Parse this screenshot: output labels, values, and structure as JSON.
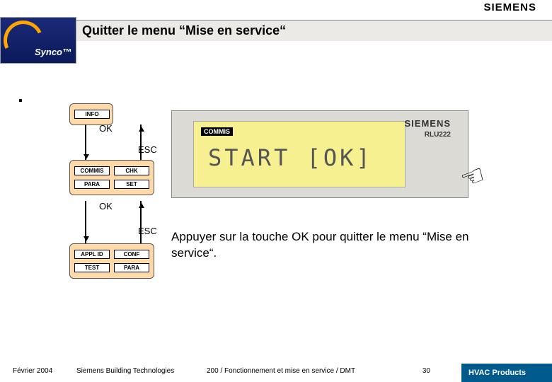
{
  "brand_top": "SIEMENS",
  "synco_label": "Synco™",
  "title": "Quitter le menu “Mise en service“",
  "dot": "▪",
  "menu1": {
    "info": "INFO"
  },
  "menu2": {
    "commis": "COMMIS",
    "chk": "CHK",
    "para": "PARA",
    "set": "SET"
  },
  "menu3": {
    "appl": "APPL ID",
    "conf": "CONF",
    "test": "TEST",
    "para": "PARA"
  },
  "labels": {
    "ok": "OK",
    "esc": "ESC"
  },
  "device": {
    "commis": "COMMIS",
    "display": "START  [OK]",
    "brand": "SIEMENS",
    "model": "RLU222"
  },
  "instruction": "Appuyer sur la touche OK pour quitter le menu “Mise en service“.",
  "footer": {
    "date": "Février 2004",
    "company": "Siemens Building Technologies",
    "mid": "200 / Fonctionnement et mise en service / DMT",
    "page": "30",
    "product": "HVAC Products"
  }
}
